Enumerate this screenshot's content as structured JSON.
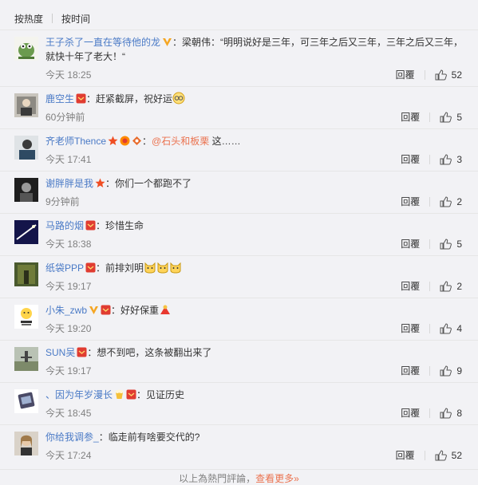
{
  "sort": {
    "hot": "按热度",
    "time": "按时间"
  },
  "comments": [
    {
      "user": "王子杀了一直在等待他的龙",
      "text": "梁朝伟：“明明说好是三年，可三年之后又三年，三年之后又三年，就快十年了老大！“",
      "time": "今天 18:25",
      "reply": "回覆",
      "likes": "52"
    },
    {
      "user": "鹿空生",
      "text": "赶紧截屏，祝好运",
      "time": "60分钟前",
      "reply": "回覆",
      "likes": "5"
    },
    {
      "user": "齐老师Thence",
      "mention": "@石头和板栗",
      "text": " 这……",
      "time": "今天 17:41",
      "reply": "回覆",
      "likes": "3"
    },
    {
      "user": "谢胖胖是我",
      "text": "你们一个都跑不了",
      "time": "9分钟前",
      "reply": "回覆",
      "likes": "2"
    },
    {
      "user": "马路的烟",
      "text": "珍惜生命",
      "time": "今天 18:38",
      "reply": "回覆",
      "likes": "5"
    },
    {
      "user": "纸袋PPP",
      "text": "前排刘明",
      "time": "今天 19:17",
      "reply": "回覆",
      "likes": "2"
    },
    {
      "user": "小朱_zwb",
      "text": "好好保重",
      "time": "今天 19:20",
      "reply": "回覆",
      "likes": "4"
    },
    {
      "user": "SUN吴",
      "text": "想不到吧，这条被翻出来了",
      "time": "今天 19:17",
      "reply": "回覆",
      "likes": "9"
    },
    {
      "user": "、因为年岁漫长",
      "text": "见证历史",
      "time": "今天 18:45",
      "reply": "回覆",
      "likes": "8"
    },
    {
      "user": "你给我调参_",
      "text": "临走前有啥要交代的?",
      "time": "今天 17:24",
      "reply": "回覆",
      "likes": "52"
    }
  ],
  "footer": {
    "text": "以上為熱門評論，",
    "link": "查看更多»"
  },
  "colors": {
    "username": "#eb7350",
    "vip": "#f5a623",
    "badge_red": "#e03c31"
  }
}
